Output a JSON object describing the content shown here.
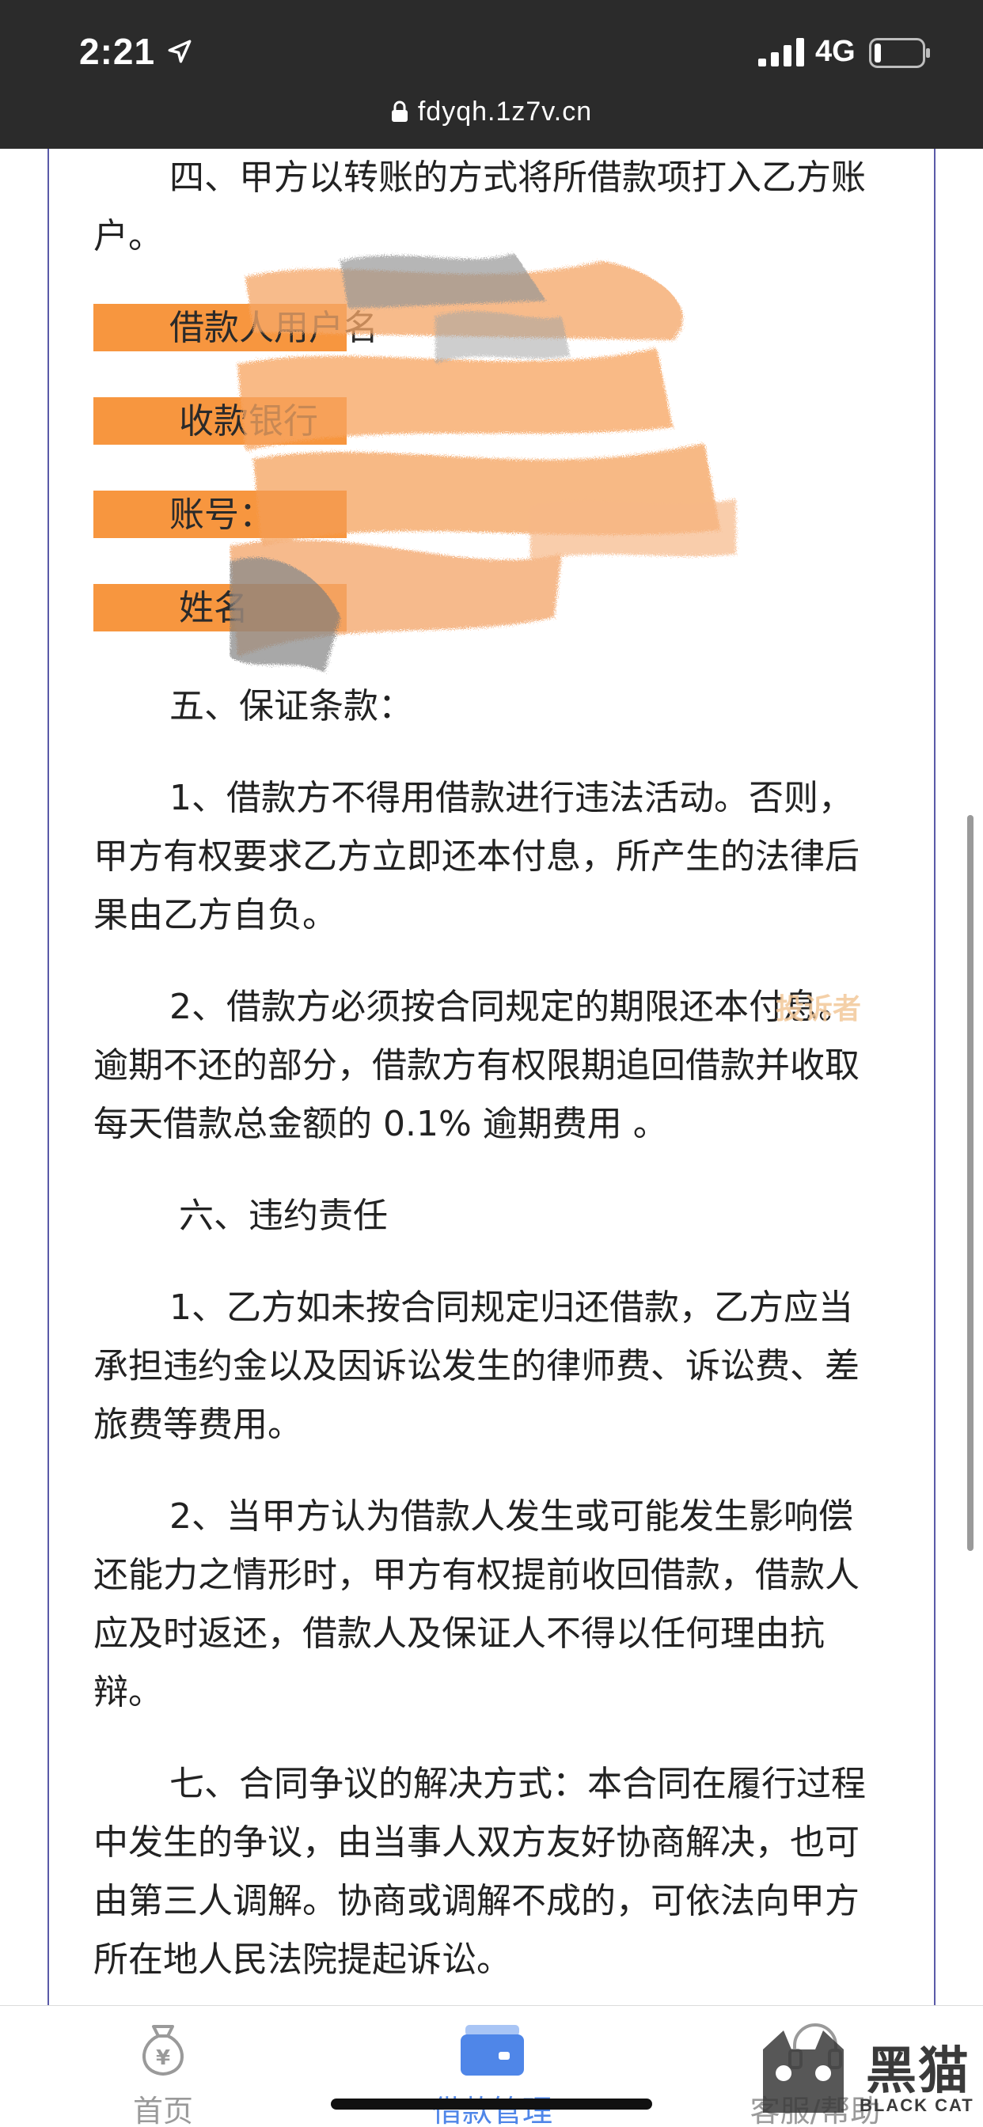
{
  "status_bar": {
    "time": "2:21",
    "network": "4G"
  },
  "browser": {
    "url": "fdyqh.1z7v.cn"
  },
  "document": {
    "section4": "四、甲方以转账的方式将所借款项打入乙方账户。",
    "fields": [
      {
        "label": "借款人用户名"
      },
      {
        "label": "收款银行"
      },
      {
        "label": "账号："
      },
      {
        "label": "姓名"
      }
    ],
    "section5_title": "五、保证条款：",
    "section5_p1": "1、借款方不得用借款进行违法活动。否则，甲方有权要求乙方立即还本付息，所产生的法律后果由乙方自负。",
    "section5_p2": "2、借款方必须按合同规定的期限还本付息。逾期不还的部分，借款方有权限期追回借款并收取每天借款总金额的 0.1% 逾期费用 。",
    "section6_title": "六、违约责任",
    "section6_p1": "1、乙方如未按合同规定归还借款，乙方应当承担违约金以及因诉讼发生的律师费、诉讼费、差旅费等费用。",
    "section6_p2": "2、当甲方认为借款人发生或可能发生影响偿还能力之情形时，甲方有权提前收回借款，借款人应及时返还，借款人及保证人不得以任何理由抗辩。",
    "section7": "七、合同争议的解决方式：本合同在履行过程中发生的争议，由当事人双方友好协商解决，也可由第三人调解。协商或调解不成的，可依法向甲方所在地人民法院提起诉讼。"
  },
  "watermark": "投诉者",
  "tabbar": {
    "tabs": [
      {
        "label": "首页",
        "icon": "money-bag-icon",
        "active": false
      },
      {
        "label": "借款管理",
        "icon": "card-icon",
        "active": true
      },
      {
        "label": "客服/帮助",
        "icon": "service-icon",
        "active": false
      }
    ]
  },
  "logo": {
    "cn": "黑猫",
    "en": "BLACK CAT"
  },
  "colors": {
    "topbar": "#2b2b2b",
    "field_highlight": "#f7963f",
    "tab_active": "#4f86e8",
    "tab_inactive": "#9a9a9a"
  }
}
